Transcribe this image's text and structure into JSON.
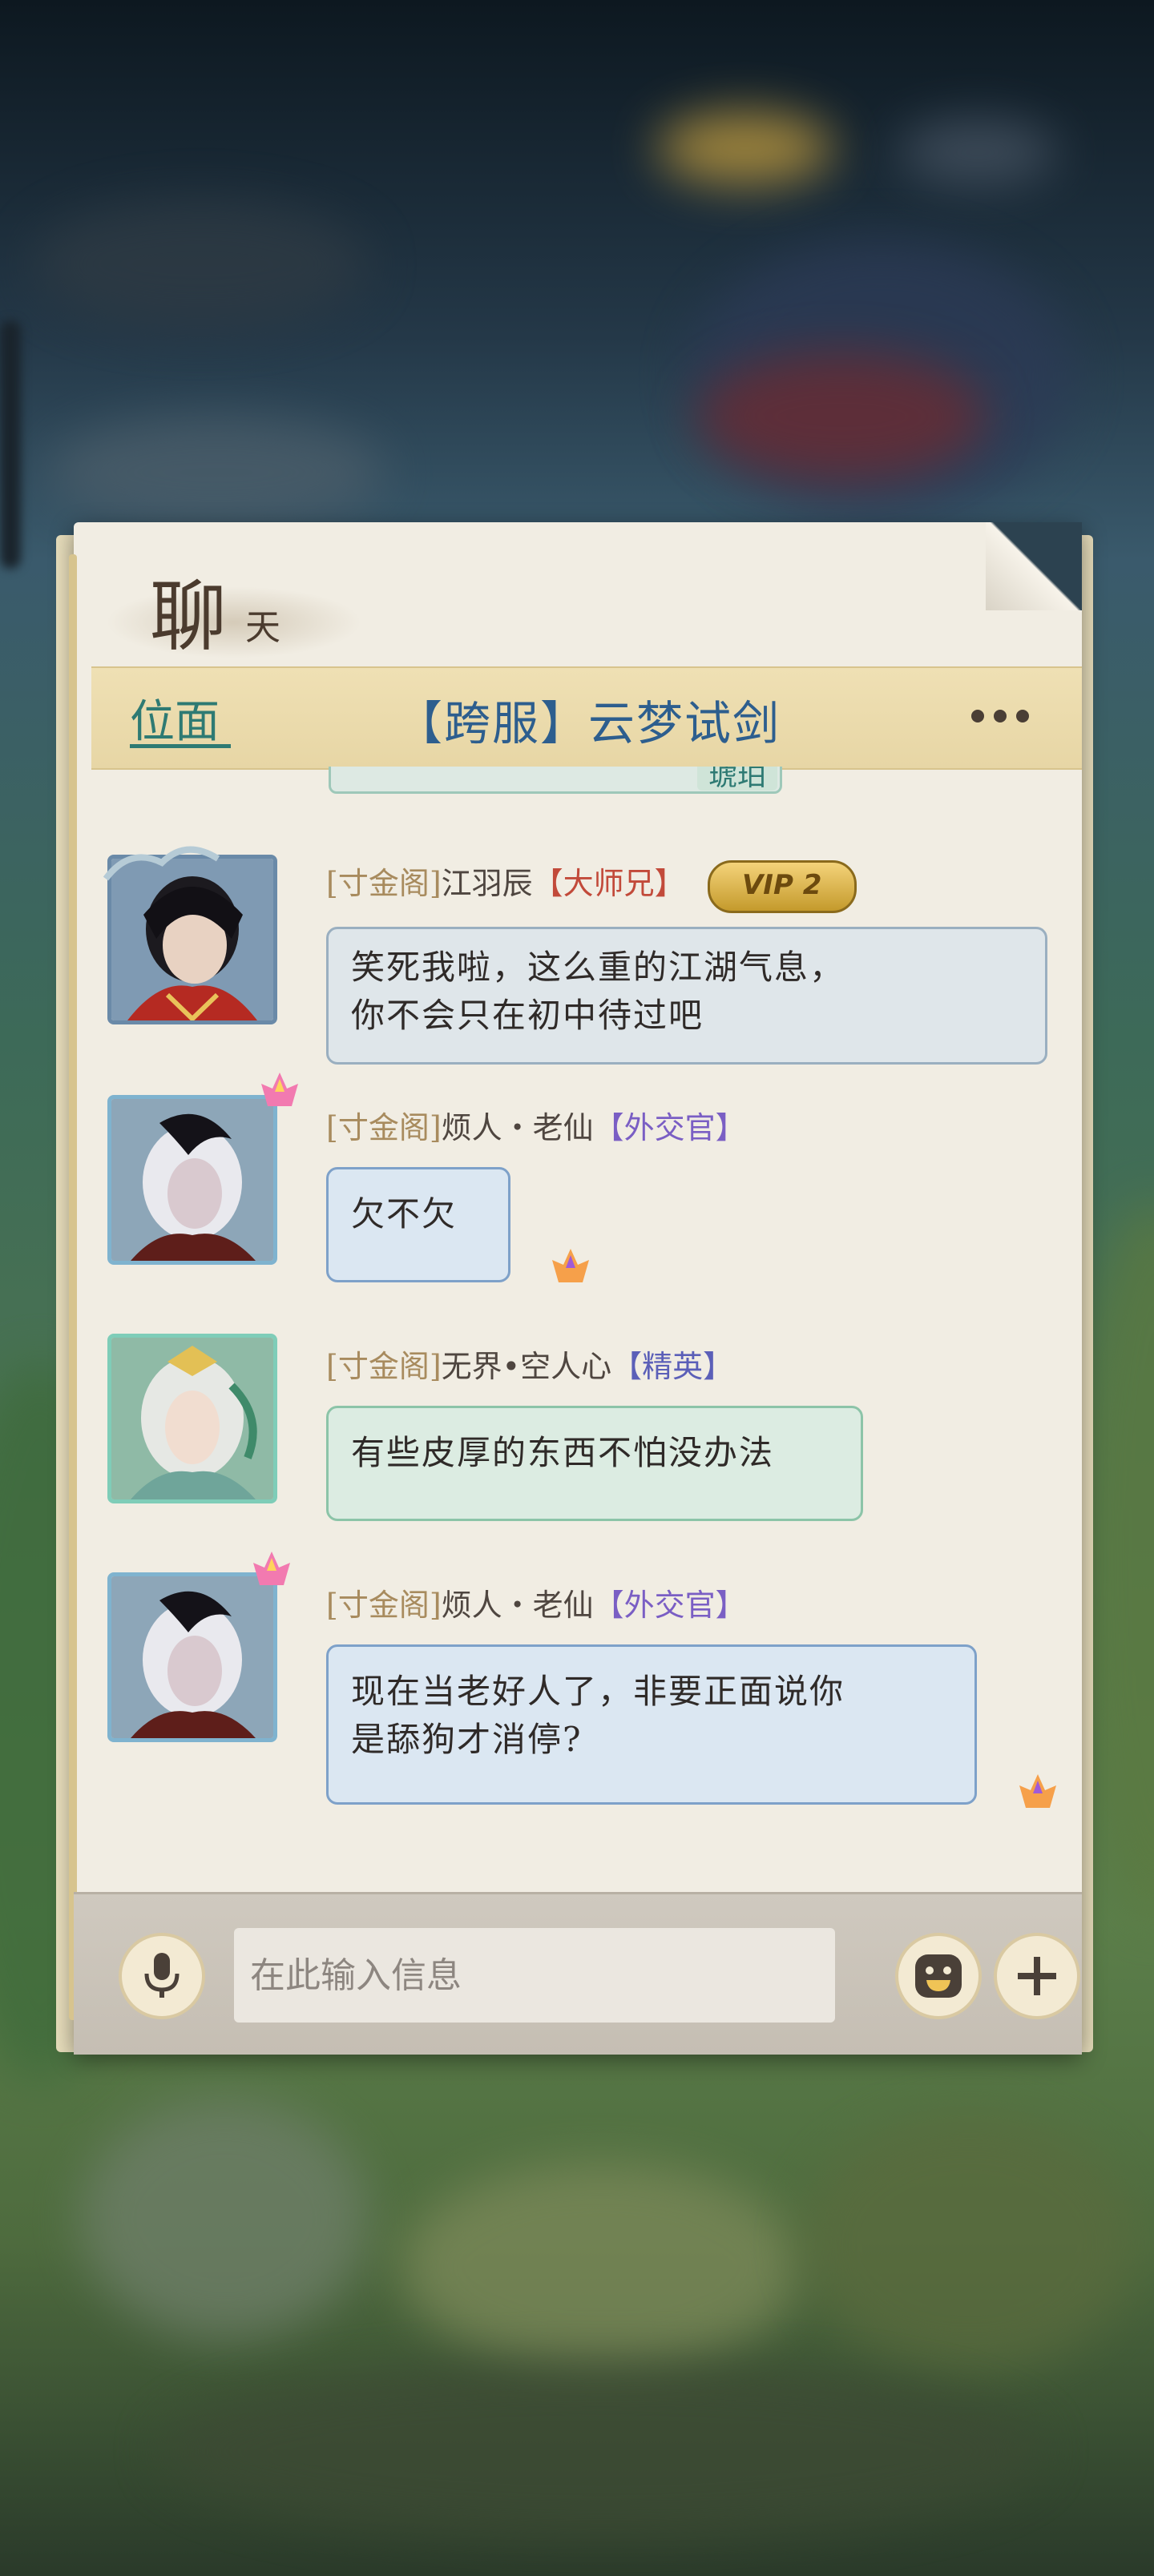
{
  "panel": {
    "title": "聊",
    "title_sub": "天",
    "tab_left": "位面",
    "tab_center": "【跨服】云梦试剑",
    "more_icon": "more-dots-icon"
  },
  "previous_message": {
    "chip": "琥珀"
  },
  "messages": [
    {
      "guild": "[寸金阁]",
      "name": "江羽辰",
      "title": "【大师兄】",
      "vip": "VIP 2",
      "text_line1": "笑死我啦，这么重的江湖气息，",
      "text_line2": "你不会只在初中待过吧"
    },
    {
      "guild": "[寸金阁]",
      "name": "烦人・老仙",
      "title": "【外交官】",
      "text_line1": "欠不欠"
    },
    {
      "guild": "[寸金阁]",
      "name": "无界•空人心",
      "title": "【精英】",
      "text_line1": "有些皮厚的东西不怕没办法"
    },
    {
      "guild": "[寸金阁]",
      "name": "烦人・老仙",
      "title": "【外交官】",
      "text_line1": "现在当老好人了，非要正面说你",
      "text_line2": "是舔狗才消停?"
    }
  ],
  "input": {
    "placeholder": "在此输入信息",
    "value": "",
    "voice_icon": "microphone-icon",
    "emoji_icon": "emoji-face-icon",
    "add_icon": "plus-icon"
  },
  "colors": {
    "accent_teal": "#2e7a73",
    "channel_blue": "#2d5e8e",
    "title_red": "#c24a3a",
    "title_purple": "#7a5ec4",
    "vip_gold": "#c49a2c"
  }
}
